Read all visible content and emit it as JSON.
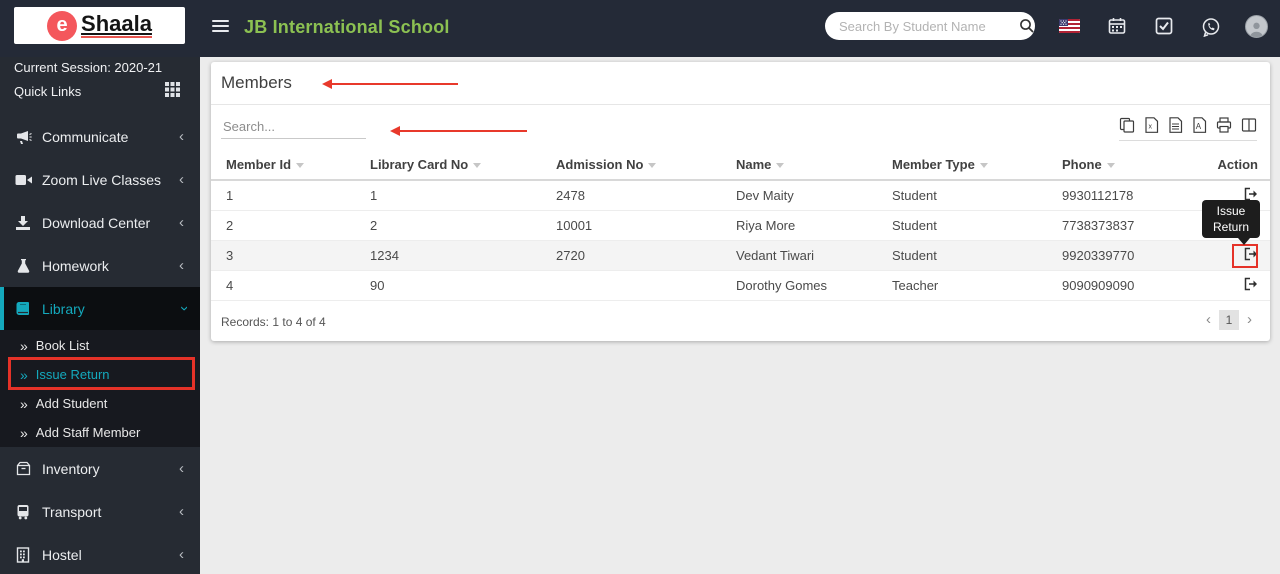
{
  "brand": {
    "logo_initial": "e",
    "logo_name": "Shaala"
  },
  "header": {
    "school_name": "JB International School",
    "search_placeholder": "Search By Student Name",
    "icons": [
      "search-icon",
      "us-flag-icon",
      "calendar-icon",
      "tasks-icon",
      "whatsapp-icon",
      "profile-avatar"
    ]
  },
  "sidebar": {
    "session": "Current Session: 2020-21",
    "quick_links": "Quick Links",
    "items": [
      {
        "label": "Communicate",
        "icon": "megaphone-icon"
      },
      {
        "label": "Zoom Live Classes",
        "icon": "video-icon"
      },
      {
        "label": "Download Center",
        "icon": "download-icon"
      },
      {
        "label": "Homework",
        "icon": "flask-icon"
      },
      {
        "label": "Library",
        "icon": "book-icon"
      },
      {
        "label": "Inventory",
        "icon": "inventory-icon"
      },
      {
        "label": "Transport",
        "icon": "bus-icon"
      },
      {
        "label": "Hostel",
        "icon": "building-icon"
      }
    ],
    "library_submenu": [
      {
        "label": "Book List"
      },
      {
        "label": "Issue Return"
      },
      {
        "label": "Add Student"
      },
      {
        "label": "Add Staff Member"
      }
    ]
  },
  "members_card": {
    "title": "Members",
    "filter_placeholder": "Search...",
    "export_icons": [
      "copy-icon",
      "excel-icon",
      "file-text-icon",
      "pdf-icon",
      "print-icon",
      "columns-icon"
    ],
    "columns": [
      "Member Id",
      "Library Card No",
      "Admission No",
      "Name",
      "Member Type",
      "Phone",
      "Action"
    ],
    "rows": [
      {
        "member_id": "1",
        "library_card_no": "1",
        "admission_no": "2478",
        "name": "Dev Maity",
        "member_type": "Student",
        "phone": "9930112178"
      },
      {
        "member_id": "2",
        "library_card_no": "2",
        "admission_no": "10001",
        "name": "Riya More",
        "member_type": "Student",
        "phone": "7738373837"
      },
      {
        "member_id": "3",
        "library_card_no": "1234",
        "admission_no": "2720",
        "name": "Vedant Tiwari",
        "member_type": "Student",
        "phone": "9920339770"
      },
      {
        "member_id": "4",
        "library_card_no": "90",
        "admission_no": "",
        "name": "Dorothy Gomes",
        "member_type": "Teacher",
        "phone": "9090909090"
      }
    ],
    "records_text": "Records: 1 to 4 of 4",
    "pagination": {
      "prev": "‹",
      "page": "1",
      "next": "›"
    }
  },
  "tooltip": {
    "text": "Issue Return"
  },
  "colors": {
    "header_bg": "#242a37",
    "sidebar_bg": "#262b33",
    "accent_teal": "#14a9bd",
    "title_green": "#8cc152",
    "annotation_red": "#e8392b",
    "logo_red": "#f4575c"
  }
}
